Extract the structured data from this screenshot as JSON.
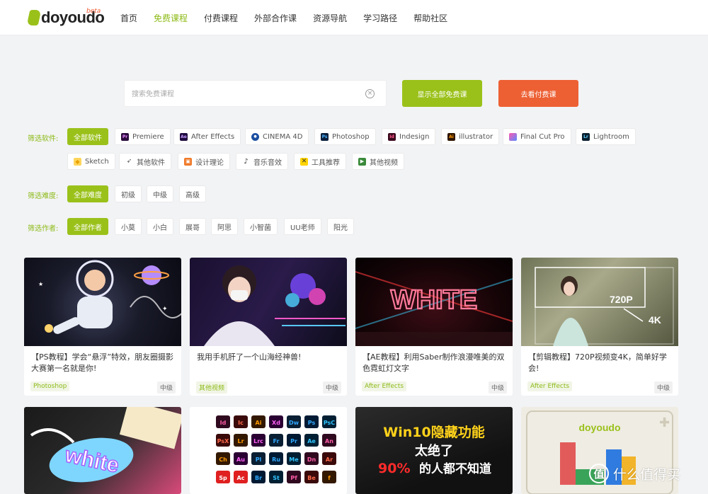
{
  "header": {
    "logo_text": "doyoudo",
    "logo_badge": "beta",
    "nav": [
      "首页",
      "免费课程",
      "付费课程",
      "外部合作课",
      "资源导航",
      "学习路径",
      "帮助社区"
    ],
    "active_nav_index": 1
  },
  "search": {
    "placeholder": "搜索免费课程",
    "clear_icon": "×",
    "show_all_label": "显示全部免费课",
    "go_paid_label": "去看付费课"
  },
  "filters": {
    "software": {
      "label": "筛选软件:",
      "items": [
        {
          "label": "全部软件",
          "icon": null,
          "selected": true
        },
        {
          "label": "Premiere",
          "icon": "Pr",
          "icon_bg": "#2a0a3c",
          "icon_fg": "#e88bff"
        },
        {
          "label": "After Effects",
          "icon": "Ae",
          "icon_bg": "#1f0a3c",
          "icon_fg": "#c29bff"
        },
        {
          "label": "CINEMA 4D",
          "icon": "C4D",
          "icon_bg": "#1a4fa0",
          "icon_fg": "#ffffff"
        },
        {
          "label": "Photoshop",
          "icon": "Ps",
          "icon_bg": "#0a1f3c",
          "icon_fg": "#4cb4ff"
        },
        {
          "label": "Indesign",
          "icon": "Id",
          "icon_bg": "#3c0a1f",
          "icon_fg": "#ff5c8a"
        },
        {
          "label": "illustrator",
          "icon": "Ai",
          "icon_bg": "#2e1400",
          "icon_fg": "#ff9a00"
        },
        {
          "label": "Final Cut Pro",
          "icon": "FCP",
          "icon_bg": "#333333",
          "icon_fg": "#ffb0f0"
        },
        {
          "label": "Lightroom",
          "icon": "Lr",
          "icon_bg": "#0a1f2e",
          "icon_fg": "#5fd3ff"
        },
        {
          "label": "Sketch",
          "icon": "sketch-icon",
          "icon_bg": "#ffd45a",
          "icon_fg": "#e8a100"
        },
        {
          "label": "其他软件",
          "icon": "rocket-icon",
          "icon_bg": "#ffffff",
          "icon_fg": "#555555"
        },
        {
          "label": "设计理论",
          "icon": "box-icon",
          "icon_bg": "#f07a2a",
          "icon_fg": "#ffffff"
        },
        {
          "label": "音乐音效",
          "icon": "note-icon",
          "icon_bg": "#ffffff",
          "icon_fg": "#333333"
        },
        {
          "label": "工具推荐",
          "icon": "tools-icon",
          "icon_bg": "#ffd400",
          "icon_fg": "#333333"
        },
        {
          "label": "其他视频",
          "icon": "play-icon",
          "icon_bg": "#3a8a3a",
          "icon_fg": "#ffffff"
        }
      ]
    },
    "difficulty": {
      "label": "筛选难度:",
      "items": [
        "全部难度",
        "初级",
        "中级",
        "高级"
      ]
    },
    "author": {
      "label": "筛选作者:",
      "items": [
        "全部作者",
        "小莫",
        "小白",
        "展哥",
        "阿思",
        "小智菌",
        "UU老师",
        "阳光"
      ]
    }
  },
  "courses": [
    {
      "title": "【PS教程】学会“悬浮”特效，朋友圈摄影大赛第一名就是你!",
      "tag": "Photoshop",
      "level": "中级"
    },
    {
      "title": "我用手机肝了一个山海经神兽!",
      "tag": "其他视频",
      "level": "中级"
    },
    {
      "title": "【AE教程】利用Saber制作浪漫唯美的双色霓虹灯文字",
      "tag": "After Effects",
      "level": "中级",
      "thumb_text": "WHITE"
    },
    {
      "title": "【剪辑教程】720P视频变4K，简单好学会!",
      "tag": "After Effects",
      "level": "中级",
      "thumb_labels": [
        "720P",
        "4K"
      ]
    }
  ],
  "second_row": {
    "thumb1_text": "white",
    "thumb2_icons": [
      "Id",
      "Ic",
      "Ai",
      "Xd",
      "Dw",
      "Ps",
      "PsC",
      "PsX",
      "Lr",
      "Lrc",
      "Fr",
      "Pr",
      "Ae",
      "An",
      "Ch",
      "Au",
      "Pl",
      "Ru",
      "Me",
      "Dn",
      "Ar",
      "Sp",
      "Ac",
      "Br",
      "St",
      "Pf",
      "Be",
      "f"
    ],
    "thumb3_line1": "Win10隐藏功能",
    "thumb3_line2": "太绝了",
    "thumb3_line3_num": "90%",
    "thumb3_line3_rest": "的人都不知道",
    "thumb4_text": "doyoudo"
  },
  "watermark": {
    "badge": "值",
    "text": "什么值得买"
  },
  "colors": {
    "brand_green": "#9ac11a",
    "accent_orange": "#ed6034",
    "active_text": "#8dbb18"
  }
}
